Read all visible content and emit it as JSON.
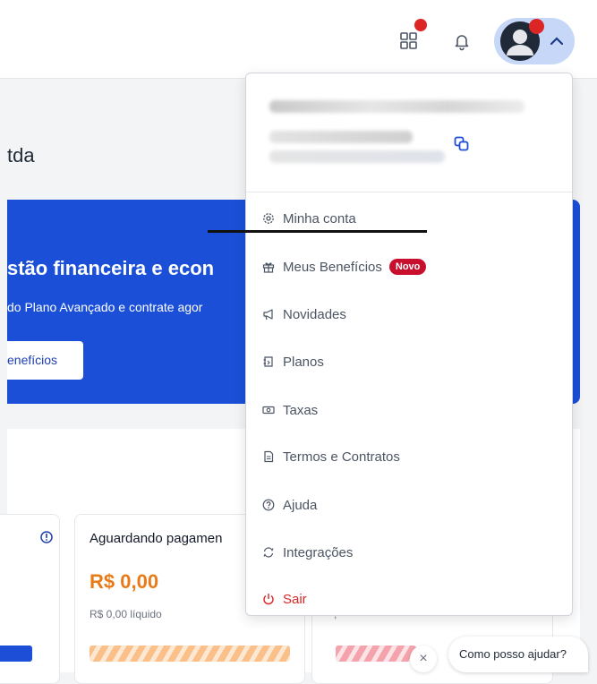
{
  "header": {
    "apps_icon": "grid-icon",
    "notifications_icon": "bell-icon",
    "profile_icon": "avatar-icon",
    "chevron_icon": "chevron-up-icon",
    "badge_color": "#dc2626"
  },
  "page": {
    "company_name_suffix": "tda",
    "banner": {
      "title": "stão financeira e econ",
      "subtitle": "do Plano Avançado e contrate agor",
      "button_label": "enefícios",
      "color": "#1b4fd8"
    },
    "cards": [
      {
        "title": "",
        "info_icon": "info-icon"
      },
      {
        "title": "Aguardando pagamen",
        "amount": "R$ 0,00",
        "net": "R$ 0,00 líquido"
      },
      {
        "net": ", "
      }
    ]
  },
  "profile_menu": {
    "copy_icon": "copy-icon",
    "items": [
      {
        "label": "Minha conta",
        "icon": "gear-icon"
      },
      {
        "label": "Meus Benefícios",
        "icon": "gift-icon",
        "badge": "Novo"
      },
      {
        "label": "Novidades",
        "icon": "megaphone-icon"
      },
      {
        "label": "Planos",
        "icon": "plans-icon"
      },
      {
        "label": "Taxas",
        "icon": "cash-icon"
      },
      {
        "label": "Termos e Contratos",
        "icon": "document-icon"
      },
      {
        "label": "Ajuda",
        "icon": "help-icon"
      },
      {
        "label": "Integrações",
        "icon": "sync-icon"
      },
      {
        "label": "Sair",
        "icon": "power-icon"
      }
    ]
  },
  "chat": {
    "bubble_text": "Como posso ajudar?",
    "close_label": "×"
  }
}
